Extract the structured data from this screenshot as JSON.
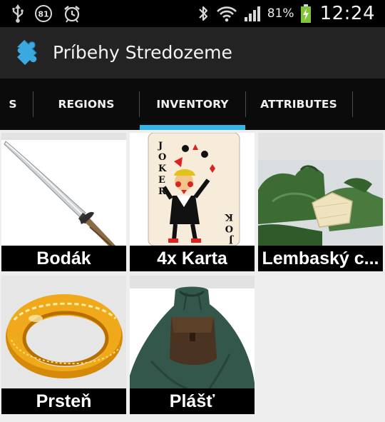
{
  "status_bar": {
    "left_icons": [
      "usb-icon",
      "notification-badge-icon",
      "alarm-icon"
    ],
    "notification_count": "81",
    "right_icons": [
      "bluetooth-icon",
      "wifi-icon",
      "signal-icon",
      "battery-charging-icon"
    ],
    "battery_percent": "81%",
    "time": "12:24"
  },
  "action_bar": {
    "app_icon": "puzzle-piece-icon",
    "title": "Príbehy Stredozeme",
    "accent_color": "#3aa9e0"
  },
  "tabs": {
    "items": [
      {
        "label": "S",
        "selected": false
      },
      {
        "label": "REGIONS",
        "selected": false
      },
      {
        "label": "INVENTORY",
        "selected": true
      },
      {
        "label": "ATTRIBUTES",
        "selected": false
      }
    ],
    "indicator_color": "#33b5e5"
  },
  "inventory": {
    "items": [
      {
        "name": "Bodák",
        "image": "dagger-image"
      },
      {
        "name": "4x Karta",
        "image": "joker-card-image"
      },
      {
        "name": "Lembaský c...",
        "image": "lembas-bread-image"
      },
      {
        "name": "Prsteň",
        "image": "gold-ring-image"
      },
      {
        "name": "Plášť",
        "image": "green-cloak-image"
      }
    ]
  }
}
